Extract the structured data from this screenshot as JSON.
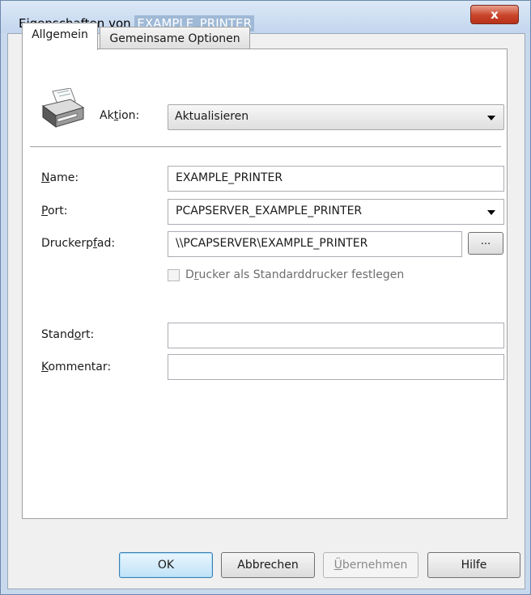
{
  "window": {
    "title_prefix": "Eigenschaften von",
    "title_name": "EXAMPLE_PRINTER",
    "close_label": "x"
  },
  "tabs": [
    {
      "label": "Allgemein",
      "active": true
    },
    {
      "label": "Gemeinsame Optionen",
      "active": false
    }
  ],
  "action": {
    "label_pre": "Ak",
    "label_u": "t",
    "label_post": "ion:",
    "value": "Aktualisieren"
  },
  "fields": {
    "name": {
      "label_u": "N",
      "label_rest": "ame:",
      "value": "EXAMPLE_PRINTER"
    },
    "port": {
      "label_u": "P",
      "label_rest": "ort:",
      "value": "PCAPSERVER_EXAMPLE_PRINTER"
    },
    "path": {
      "label_pre": "Druckerp",
      "label_u": "f",
      "label_post": "ad:",
      "value": "\\\\PCAPSERVER\\EXAMPLE_PRINTER",
      "browse_label": "..."
    },
    "default_printer": {
      "label_pre": "D",
      "label_u": "r",
      "label_post": "ucker als Standarddrucker festlegen",
      "checked": false
    },
    "location": {
      "label_pre": "Stand",
      "label_u": "o",
      "label_post": "rt:",
      "value": ""
    },
    "comment": {
      "label_u": "K",
      "label_rest": "ommentar:",
      "value": ""
    }
  },
  "buttons": {
    "ok": "OK",
    "cancel": "Abbrechen",
    "apply_u": "Ü",
    "apply_rest": "bernehmen",
    "help": "Hilfe"
  },
  "icons": {
    "printer": "printer-icon",
    "dropdown": "chevron-down-icon",
    "close": "close-icon"
  },
  "colors": {
    "title_bar": "#c3d6ee",
    "close_button": "#c9442a",
    "default_button_border": "#3c7fb1"
  }
}
